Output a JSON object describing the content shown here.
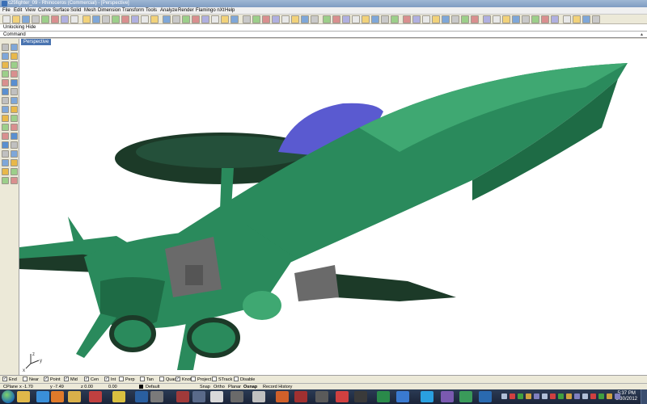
{
  "window": {
    "title": "c25fighter_09 - Rhinoceros (Commercial) - [Perspective]"
  },
  "menu": [
    "File",
    "Edit",
    "View",
    "Curve",
    "Surface",
    "Solid",
    "Mesh",
    "Dimension",
    "Transform",
    "Tools",
    "Analyze",
    "Render",
    "Flamingo nXt",
    "Help"
  ],
  "command": {
    "history": "Unlocking Hide",
    "prompt": "Command"
  },
  "viewport": {
    "label": "Perspective",
    "axis_labels": [
      "z",
      "y",
      "x"
    ]
  },
  "osnaps": [
    {
      "label": "End",
      "checked": true
    },
    {
      "label": "Near",
      "checked": false
    },
    {
      "label": "Point",
      "checked": true
    },
    {
      "label": "Mid",
      "checked": true
    },
    {
      "label": "Cen",
      "checked": true
    },
    {
      "label": "Int",
      "checked": true
    },
    {
      "label": "Perp",
      "checked": false
    },
    {
      "label": "Tan",
      "checked": false
    },
    {
      "label": "Quad",
      "checked": false
    },
    {
      "label": "Knot",
      "checked": true
    },
    {
      "label": "Project",
      "checked": false
    },
    {
      "label": "STrack",
      "checked": false
    },
    {
      "label": "Disable",
      "checked": false
    }
  ],
  "status": {
    "cplane": "CPlane",
    "x": "x -1.70",
    "y": "y -7.49",
    "z": "z 0.00",
    "other": "0.00",
    "layer": "Default",
    "snap": "Snap",
    "ortho": "Ortho",
    "planar": "Planar",
    "osnap": "Osnap",
    "record_history": "Record History"
  },
  "clock": {
    "time": "5:37 PM",
    "date": "9/30/2012"
  },
  "colors": {
    "hull": "#2a8a5c",
    "hull_dark": "#1e6b45",
    "hull_light": "#3fa872",
    "canopy": "#5a5ad0",
    "rotor": "#1c3a28",
    "engine_gray": "#6a6a6a"
  }
}
